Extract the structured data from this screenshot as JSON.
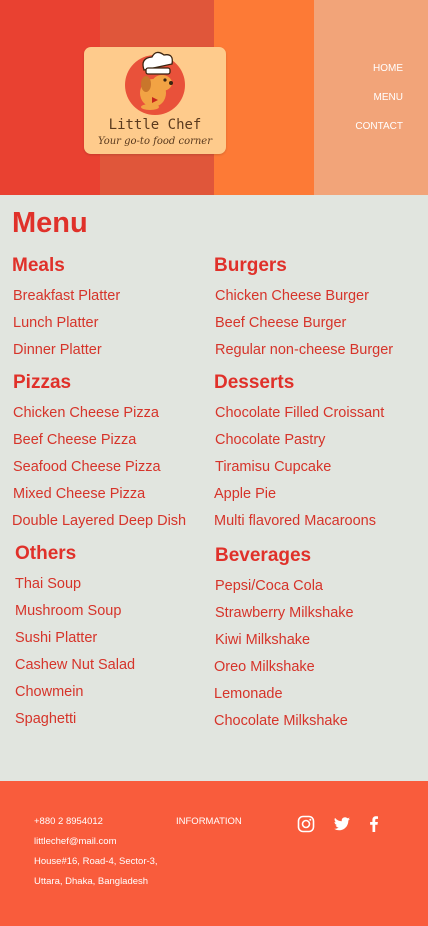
{
  "brand": {
    "name": "Little Chef",
    "tagline": "Your go-to food corner"
  },
  "nav": [
    "HOME",
    "MENU",
    "CONTACT"
  ],
  "menu": {
    "title": "Menu",
    "categories": [
      {
        "title": "Meals",
        "items": [
          "Breakfast Platter",
          "Lunch Platter",
          "Dinner Platter"
        ]
      },
      {
        "title": "Burgers",
        "items": [
          "Chicken Cheese Burger",
          "Beef Cheese Burger",
          "Regular non-cheese Burger"
        ]
      },
      {
        "title": "Pizzas",
        "items": [
          "Chicken Cheese Pizza",
          "Beef Cheese Pizza",
          "Seafood Cheese Pizza",
          "Mixed Cheese Pizza",
          "Double Layered Deep Dish"
        ]
      },
      {
        "title": "Desserts",
        "items": [
          "Chocolate Filled Croissant",
          "Chocolate Pastry",
          "Tiramisu Cupcake",
          "Apple Pie",
          "Multi flavored Macaroons"
        ]
      },
      {
        "title": "Others",
        "items": [
          "Thai Soup",
          "Mushroom Soup",
          "Sushi Platter",
          "Cashew Nut Salad",
          "Chowmein",
          "Spaghetti"
        ]
      },
      {
        "title": "Beverages",
        "items": [
          "Pepsi/Coca Cola",
          "Strawberry Milkshake",
          "Kiwi Milkshake",
          "Oreo Milkshake",
          "Lemonade",
          "Chocolate Milkshake"
        ]
      }
    ]
  },
  "footer": {
    "phone": "+880 2 8954012",
    "email": "littlechef@mail.com",
    "address_line1": "House#16, Road-4, Sector-3,",
    "address_line2": "Uttara, Dhaka, Bangladesh",
    "info_label": "INFORMATION",
    "social_icons": [
      "instagram-icon",
      "twitter-icon",
      "facebook-icon"
    ]
  },
  "colors": {
    "accent": "#e0312a",
    "footer": "#f95c3c",
    "background": "#e1e5df"
  }
}
